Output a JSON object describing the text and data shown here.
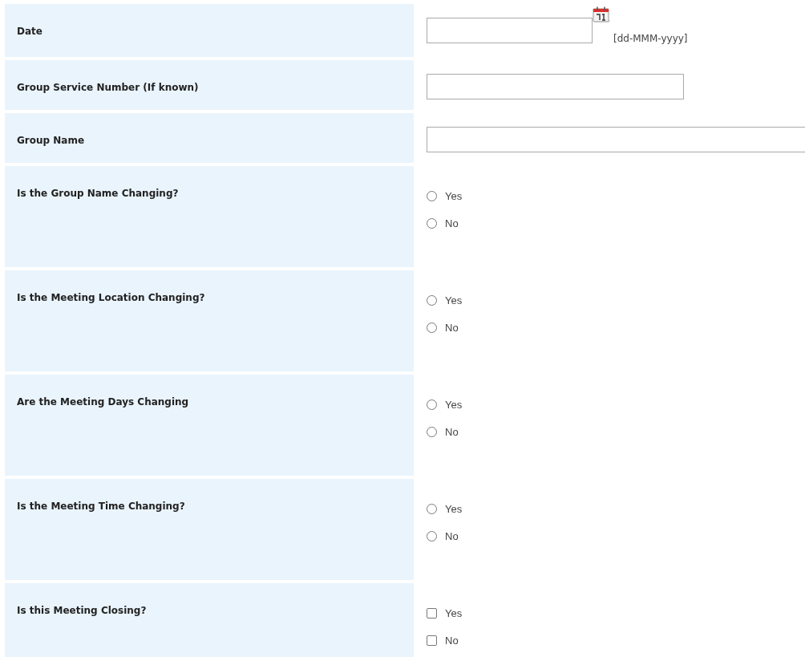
{
  "rows": [
    {
      "label": "Date",
      "kind": "date",
      "format_hint": "[dd-MMM-yyyy]"
    },
    {
      "label": "Group Service Number (If known)",
      "kind": "text"
    },
    {
      "label": "Group Name",
      "kind": "wide-text"
    },
    {
      "label": "Is the Group Name Changing?",
      "kind": "radio",
      "options": [
        {
          "label": "Yes",
          "selected": false
        },
        {
          "label": "No",
          "selected": false
        }
      ]
    },
    {
      "label": "Is the Meeting Location Changing?",
      "kind": "radio",
      "options": [
        {
          "label": "Yes",
          "selected": false
        },
        {
          "label": "No",
          "selected": false
        }
      ]
    },
    {
      "label": "Are the Meeting Days Changing",
      "kind": "radio",
      "options": [
        {
          "label": "Yes",
          "selected": false
        },
        {
          "label": "No",
          "selected": false
        }
      ]
    },
    {
      "label": "Is the Meeting Time Changing?",
      "kind": "radio",
      "options": [
        {
          "label": "Yes",
          "selected": false
        },
        {
          "label": "No",
          "selected": false
        }
      ]
    },
    {
      "label": "Is this Meeting Closing?",
      "kind": "checkbox",
      "options": [
        {
          "label": "Yes",
          "checked": false
        },
        {
          "label": "No",
          "checked": false
        }
      ]
    }
  ]
}
